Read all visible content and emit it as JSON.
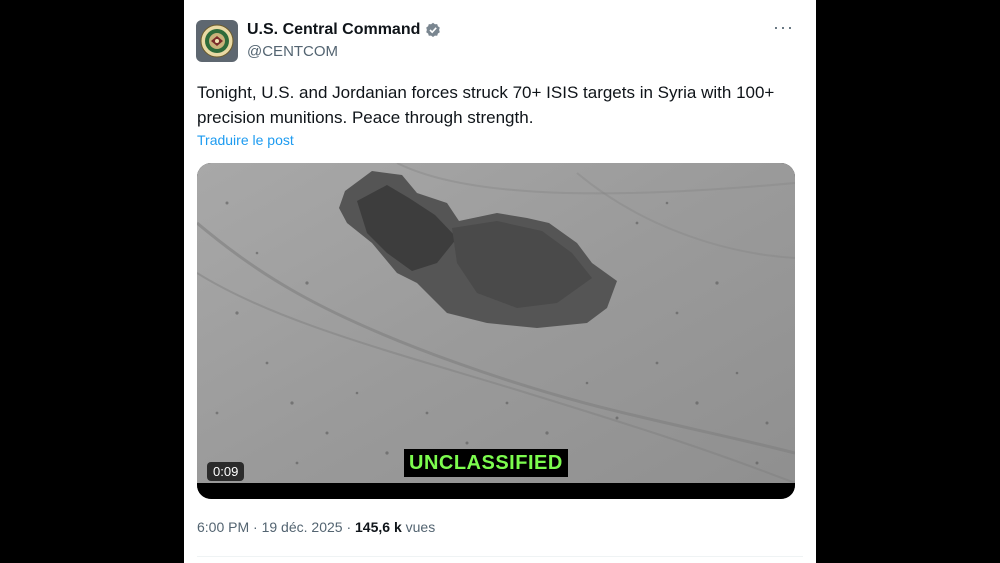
{
  "tweet": {
    "author": {
      "display_name": "U.S. Central Command",
      "handle": "@CENTCOM",
      "avatar_icon": "centcom-seal-icon",
      "verified_icon": "verified-badge-icon",
      "verified_color": "#1d9bf0"
    },
    "more_icon": "more-options-icon",
    "text": "Tonight, U.S. and Jordanian forces struck 70+ ISIS targets in Syria with 100+ precision munitions. Peace through strength.",
    "translate_label": "Traduire le post",
    "media": {
      "duration": "0:09",
      "classification_label": "UNCLASSIFIED",
      "classification_color": "#7CFC4E"
    },
    "meta": {
      "time": "6:00 PM",
      "separator": "·",
      "date": "19 déc. 2025",
      "views_count": "145,6 k",
      "views_label": "vues"
    }
  },
  "colors": {
    "background": "#000000",
    "card": "#ffffff",
    "link": "#1d9bf0",
    "secondary_text": "#536471"
  }
}
